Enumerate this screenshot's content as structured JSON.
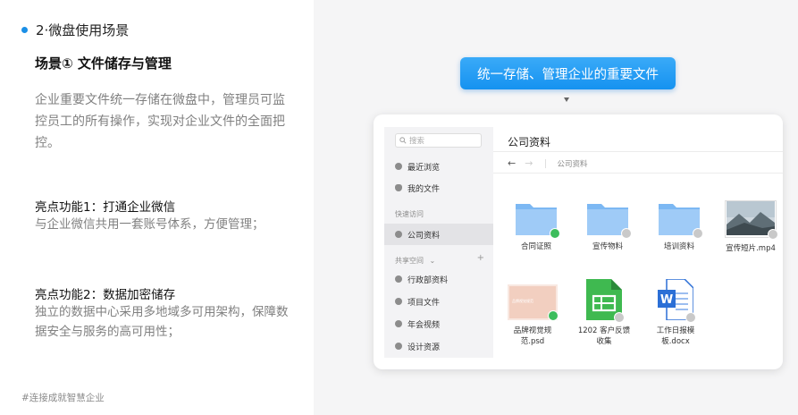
{
  "left": {
    "section_title": "2·微盘使用场景",
    "scene_title": "场景① 文件储存与管理",
    "intro": "企业重要文件统一存储在微盘中，管理员可监控员工的所有操作，实现对企业文件的全面把控。",
    "highlights": [
      {
        "title": "亮点功能1：打通企业微信",
        "desc": "与企业微信共用一套账号体系，方便管理；"
      },
      {
        "title": "亮点功能2：数据加密储存",
        "desc": "独立的数据中心采用多地域多可用架构，保障数据安全与服务的高可用性；"
      }
    ],
    "tag": "#连接成就智慧企业"
  },
  "banner": "统一存储、管理企业的重要文件",
  "app": {
    "search_placeholder": "搜索",
    "nav_items": [
      {
        "label": "最近浏览",
        "icon": "clock-icon"
      },
      {
        "label": "我的文件",
        "icon": "user-icon"
      }
    ],
    "quick_access_label": "快速访问",
    "quick_items": [
      {
        "label": "公司资料",
        "active": true
      }
    ],
    "shared_label": "共享空间",
    "shared_items": [
      "行政部资料",
      "项目文件",
      "年会视频",
      "设计资源"
    ],
    "main_title": "公司资料",
    "breadcrumb": "公司资料",
    "files": [
      {
        "name": "合同证照",
        "type": "folder",
        "badge": "ok"
      },
      {
        "name": "宣传物料",
        "type": "folder",
        "badge": "gray"
      },
      {
        "name": "培训资料",
        "type": "folder",
        "badge": "gray"
      },
      {
        "name": "宣传短片.mp4",
        "type": "video",
        "badge": "gray"
      },
      {
        "name": "品牌视觉规范.psd",
        "type": "psd",
        "badge": "ok",
        "thumb_text": "品牌视觉规范"
      },
      {
        "name": "1202 客户反馈收集",
        "type": "sheet",
        "badge": "gray"
      },
      {
        "name": "工作日报模板.docx",
        "type": "docx",
        "badge": "gray"
      }
    ]
  }
}
